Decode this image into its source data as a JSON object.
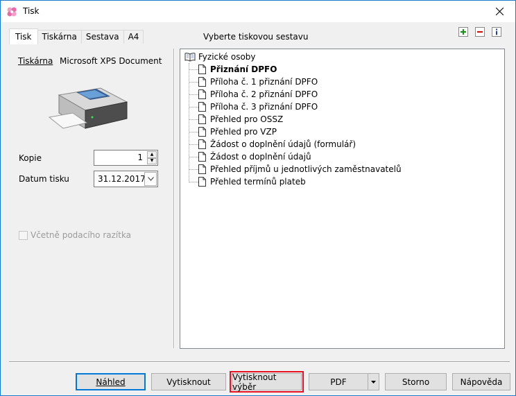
{
  "window": {
    "title": "Tisk"
  },
  "tabs": [
    {
      "label": "Tisk",
      "active": true
    },
    {
      "label": "Tiskárna",
      "active": false
    },
    {
      "label": "Sestava",
      "active": false
    },
    {
      "label": "A4",
      "active": false
    }
  ],
  "left": {
    "printer_label": "Tiskárna",
    "printer_name": "Microsoft XPS Document",
    "copies_label": "Kopie",
    "copies_value": "1",
    "date_label": "Datum tisku",
    "date_value": "31.12.2017",
    "stamp_label": "Včetně podacího razítka",
    "stamp_checked": false
  },
  "right": {
    "title": "Vyberte tiskovou sestavu",
    "tree_root": "Fyzické osoby",
    "items": [
      {
        "label": "Přiznání DPFO",
        "selected": true
      },
      {
        "label": "Příloha č. 1 přiznání DPFO",
        "selected": false
      },
      {
        "label": "Příloha č. 2 přiznání DPFO",
        "selected": false
      },
      {
        "label": "Příloha č. 3 přiznání DPFO",
        "selected": false
      },
      {
        "label": "Přehled pro OSSZ",
        "selected": false
      },
      {
        "label": "Přehled pro VZP",
        "selected": false
      },
      {
        "label": "Žádost o doplnění údajů (formulář)",
        "selected": false
      },
      {
        "label": "Žádost o doplnění údajů",
        "selected": false
      },
      {
        "label": "Přehled příjmů u jednotlivých zaměstnavatelů",
        "selected": false
      },
      {
        "label": "Přehled termínů plateb",
        "selected": false
      }
    ]
  },
  "buttons": {
    "preview": "Náhled",
    "print": "Vytisknout",
    "print_selection": "Vytisknout výběr",
    "pdf": "PDF",
    "cancel": "Storno",
    "help": "Nápověda"
  },
  "colors": {
    "accent": "#0078d7",
    "highlight": "#e81123",
    "add": "#1e8c1e",
    "remove": "#d01010",
    "info": "#1a3fb0"
  }
}
